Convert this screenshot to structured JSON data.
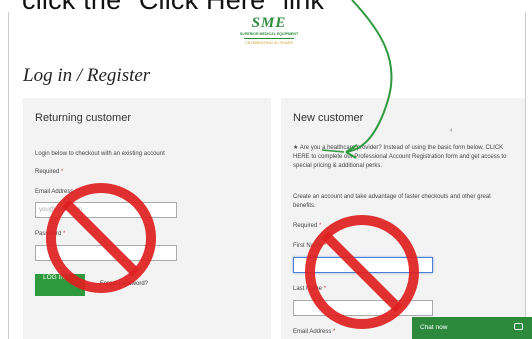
{
  "instruction": "click the \"Click Here\" link",
  "logo": {
    "mark": "SME",
    "subtitle": "SUPERIOR MEDICAL EQUIPMENT",
    "celebrating": "CELEBRATING 30 YEARS",
    "green": "#2e8b3e",
    "gold": "#c9a227"
  },
  "page_title": "Log in / Register",
  "returning": {
    "heading": "Returning customer",
    "intro": "Login below to checkout with an existing account",
    "required": "Required",
    "email_label": "Email Address",
    "email_placeholder": "you@email.com",
    "password_label": "Password",
    "login_button": "LOG IN",
    "forgot_link": "Forgot password?"
  },
  "new_customer": {
    "heading": "New customer",
    "provider_text": "Are you a healthcare provider? Instead of using the basic form below, CLICK HERE to complete our Professional Account Registration form and get access to special pricing & additional perks.",
    "account_text": "Create an account and take advantage of faster checkouts and other great benefits.",
    "required": "Required",
    "first_name_label": "First Name",
    "last_name_label": "Last Name",
    "email_label": "Email Address"
  },
  "chat": {
    "label": "Chat now",
    "icon": "chat-bubble-icon",
    "color": "#2d8a3c"
  },
  "annotation_colors": {
    "prohibited": "#e02020",
    "arrow": "#2e9a3e"
  }
}
